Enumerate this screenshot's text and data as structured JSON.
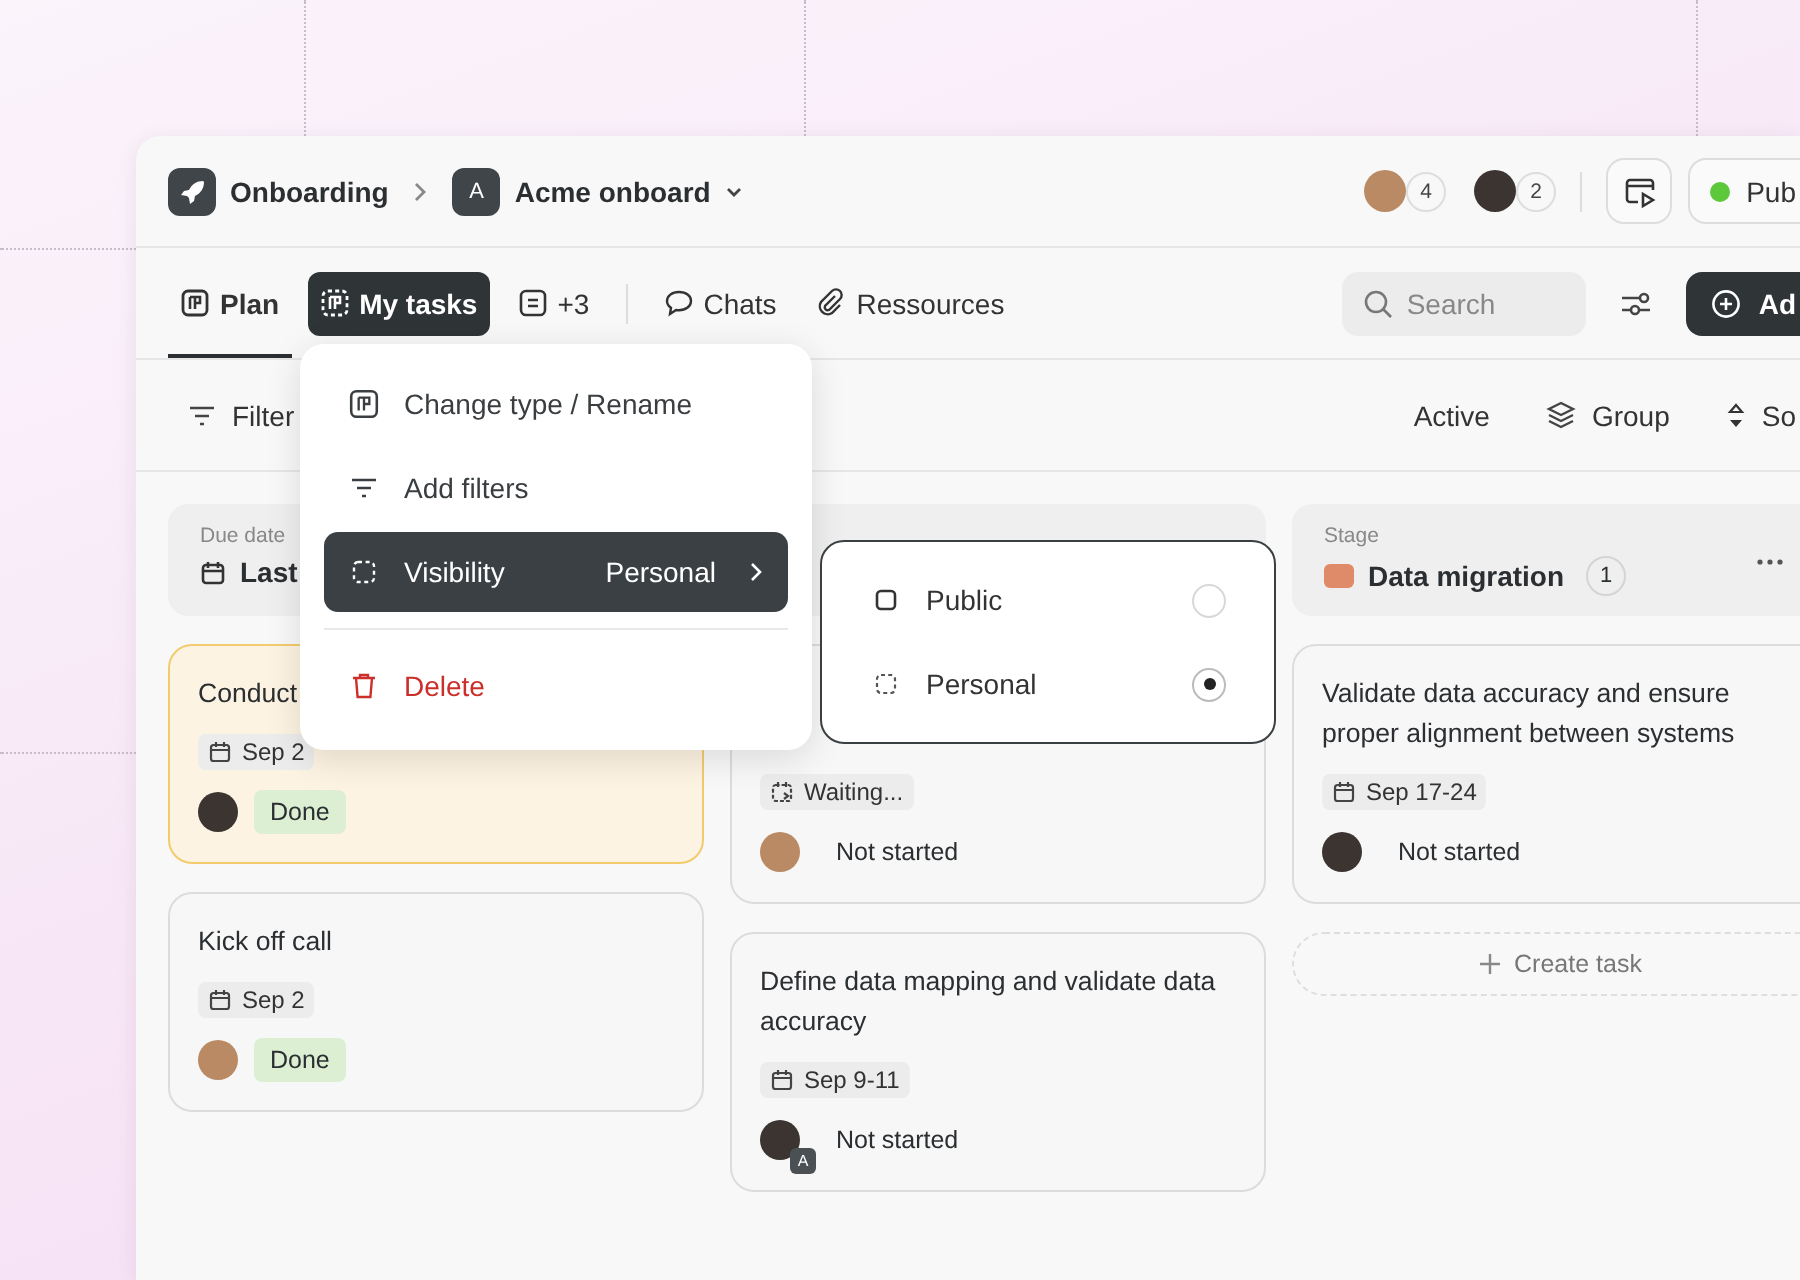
{
  "breadcrumb": [
    {
      "label": "Onboarding",
      "kind": "project"
    },
    {
      "label": "Acme onboard",
      "badge": "A",
      "kind": "board"
    }
  ],
  "presence": [
    {
      "count": "4"
    },
    {
      "count": "2"
    }
  ],
  "publish_button": {
    "label": "Pub"
  },
  "tabs": [
    {
      "label": "Plan",
      "kind": "plan",
      "selected": true,
      "open": false
    },
    {
      "label": "My tasks",
      "kind": "personal",
      "selected": false,
      "open": true
    },
    {
      "label": "+3",
      "kind": "more",
      "selected": false,
      "open": false
    },
    {
      "label": "Chats",
      "kind": "chat",
      "selected": false,
      "open": false
    },
    {
      "label": "Ressources",
      "kind": "link",
      "selected": false,
      "open": false
    }
  ],
  "search": {
    "placeholder": "Search"
  },
  "add_button": {
    "label": "Ad"
  },
  "toolbar": {
    "filter": "Filter",
    "active": "Active",
    "group": "Group",
    "sort": "So"
  },
  "columns": [
    {
      "label": "Due date",
      "title": "Last",
      "cards": [
        {
          "title": "Conduct",
          "tag": {
            "label": "Sep 2",
            "kind": "date"
          },
          "status": {
            "label": "Done",
            "kind": "done"
          },
          "highlighted": true
        },
        {
          "title": "Kick off call",
          "tag": {
            "label": "Sep 2",
            "kind": "date"
          },
          "status": {
            "label": "Done",
            "kind": "done"
          },
          "highlighted": false
        }
      ]
    },
    {
      "cards": [
        {
          "tag": {
            "label": "Waiting...",
            "kind": "waiting"
          },
          "status": {
            "label": "Not started",
            "kind": "not_started"
          },
          "highlighted": false
        },
        {
          "title": "Define data mapping and validate data accuracy",
          "tag": {
            "label": "Sep 9-11",
            "kind": "date"
          },
          "status": {
            "label": "Not started",
            "kind": "not_started"
          },
          "badge": "A",
          "highlighted": false
        }
      ]
    },
    {
      "label": "Stage",
      "title": "Data migration",
      "color": "#df8a68",
      "count": "1",
      "create": "Create task",
      "cards": [
        {
          "title": "Validate data accuracy and ensure proper alignment between systems",
          "tag": {
            "label": "Sep 17-24",
            "kind": "date"
          },
          "status": {
            "label": "Not started",
            "kind": "not_started"
          },
          "highlighted": false
        }
      ]
    }
  ],
  "context_menu": {
    "items": [
      {
        "label": "Change type / Rename",
        "kind": "rename",
        "selected": false
      },
      {
        "label": "Add filters",
        "kind": "filters",
        "selected": false
      },
      {
        "label": "Visibility",
        "value": "Personal",
        "kind": "submenu",
        "selected": true
      },
      {
        "label": "Delete",
        "kind": "danger",
        "selected": false
      }
    ]
  },
  "submenu": {
    "options": [
      {
        "label": "Public",
        "kind": "public",
        "selected": false
      },
      {
        "label": "Personal",
        "kind": "personal",
        "selected": true
      }
    ]
  }
}
